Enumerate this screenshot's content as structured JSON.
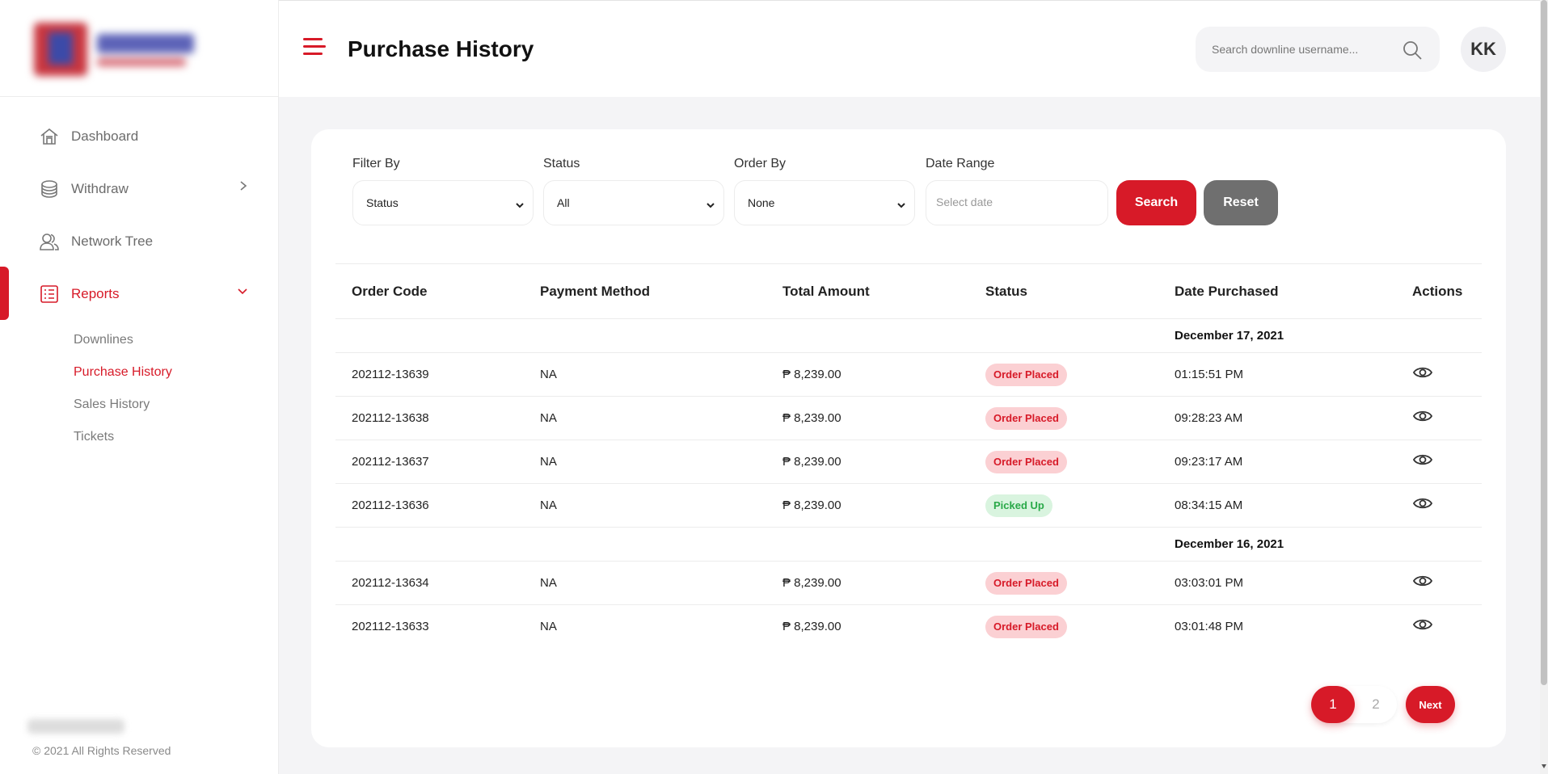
{
  "header": {
    "title": "Purchase History",
    "search_placeholder": "Search downline username...",
    "avatar_initials": "KK"
  },
  "sidebar": {
    "items": [
      {
        "label": "Dashboard",
        "icon": "home-icon"
      },
      {
        "label": "Withdraw",
        "icon": "coins-icon"
      },
      {
        "label": "Network Tree",
        "icon": "users-icon"
      },
      {
        "label": "Reports",
        "icon": "list-icon"
      }
    ],
    "subitems": [
      "Downlines",
      "Purchase History",
      "Sales History",
      "Tickets"
    ],
    "active_item": "Reports",
    "active_subitem": "Purchase History",
    "copyright": "© 2021 All Rights Reserved"
  },
  "filters": {
    "filter_by": {
      "label": "Filter By",
      "value": "Status"
    },
    "status": {
      "label": "Status",
      "value": "All"
    },
    "order_by": {
      "label": "Order By",
      "value": "None"
    },
    "date_range": {
      "label": "Date Range",
      "placeholder": "Select date"
    },
    "search_label": "Search",
    "reset_label": "Reset"
  },
  "table": {
    "columns": [
      "Order Code",
      "Payment Method",
      "Total Amount",
      "Status",
      "Date Purchased",
      "Actions"
    ],
    "groups": [
      {
        "date": "December 17, 2021",
        "rows": [
          {
            "code": "202112-13639",
            "payment": "NA",
            "amount": "₱ 8,239.00",
            "status": "Order Placed",
            "time": "01:15:51 PM"
          },
          {
            "code": "202112-13638",
            "payment": "NA",
            "amount": "₱ 8,239.00",
            "status": "Order Placed",
            "time": "09:28:23 AM"
          },
          {
            "code": "202112-13637",
            "payment": "NA",
            "amount": "₱ 8,239.00",
            "status": "Order Placed",
            "time": "09:23:17 AM"
          },
          {
            "code": "202112-13636",
            "payment": "NA",
            "amount": "₱ 8,239.00",
            "status": "Picked Up",
            "time": "08:34:15 AM"
          }
        ]
      },
      {
        "date": "December 16, 2021",
        "rows": [
          {
            "code": "202112-13634",
            "payment": "NA",
            "amount": "₱ 8,239.00",
            "status": "Order Placed",
            "time": "03:03:01 PM"
          },
          {
            "code": "202112-13633",
            "payment": "NA",
            "amount": "₱ 8,239.00",
            "status": "Order Placed",
            "time": "03:01:48 PM"
          }
        ]
      }
    ]
  },
  "pagination": {
    "pages": [
      "1",
      "2"
    ],
    "current": "1",
    "next_label": "Next"
  },
  "colors": {
    "accent": "#d71a28",
    "order_placed_bg": "#fbd0d3",
    "picked_up_bg": "#d9f4df",
    "picked_up_text": "#29a948"
  }
}
